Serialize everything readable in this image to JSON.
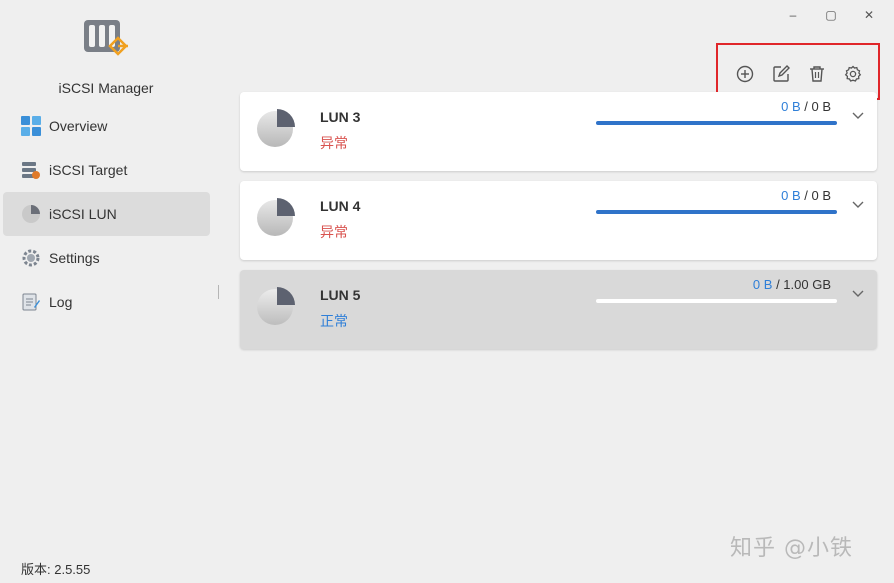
{
  "app": {
    "title": "iSCSI Manager",
    "version": "版本: 2.5.55"
  },
  "window_controls": {
    "minimize": "–",
    "maximize": "▢",
    "close": "✕"
  },
  "nav": {
    "items": [
      {
        "label": "Overview",
        "icon": "overview-icon"
      },
      {
        "label": "iSCSI Target",
        "icon": "target-icon"
      },
      {
        "label": "iSCSI LUN",
        "icon": "lun-icon",
        "active": true
      },
      {
        "label": "Settings",
        "icon": "gear-icon"
      },
      {
        "label": "Log",
        "icon": "log-icon"
      }
    ]
  },
  "toolbar": {
    "buttons": [
      "add-icon",
      "edit-icon",
      "delete-icon",
      "settings-icon"
    ]
  },
  "luns": [
    {
      "name": "LUN 3",
      "status": "异常",
      "status_type": "error",
      "used": "0 B",
      "total": "0 B",
      "fill": 1.0,
      "selected": false
    },
    {
      "name": "LUN 4",
      "status": "异常",
      "status_type": "error",
      "used": "0 B",
      "total": "0 B",
      "fill": 1.0,
      "selected": false
    },
    {
      "name": "LUN 5",
      "status": "正常",
      "status_type": "ok",
      "used": "0 B",
      "total": "1.00 GB",
      "fill": 0.0,
      "selected": true
    }
  ],
  "watermark": "知乎 @小铁",
  "colors": {
    "accent": "#2f7fd8",
    "error": "#d9534f",
    "highlight_box": "#e0262a"
  }
}
